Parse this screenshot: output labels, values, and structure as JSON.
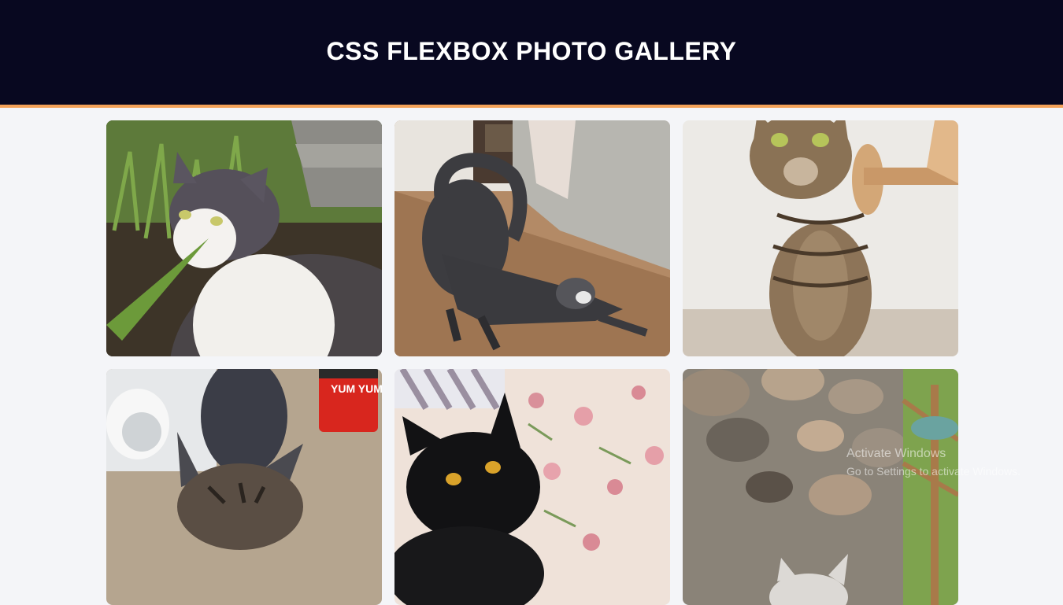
{
  "header": {
    "title": "CSS FLEXBOX PHOTO GALLERY"
  },
  "gallery": {
    "photos": [
      {
        "alt": "white-gray cat in grass"
      },
      {
        "alt": "gray tabby cat stretching"
      },
      {
        "alt": "brown tabby cat sitting"
      },
      {
        "alt": "tabby cat near cup"
      },
      {
        "alt": "black cat on floral blanket"
      },
      {
        "alt": "cat near stone wall"
      }
    ]
  },
  "cup_label": "YUM YUM",
  "watermark": {
    "line1": "Activate Windows",
    "line2": "Go to Settings to activate Windows."
  },
  "colors": {
    "header_bg": "#080820",
    "header_border": "#f4a259",
    "page_bg": "#f4f5f8"
  }
}
